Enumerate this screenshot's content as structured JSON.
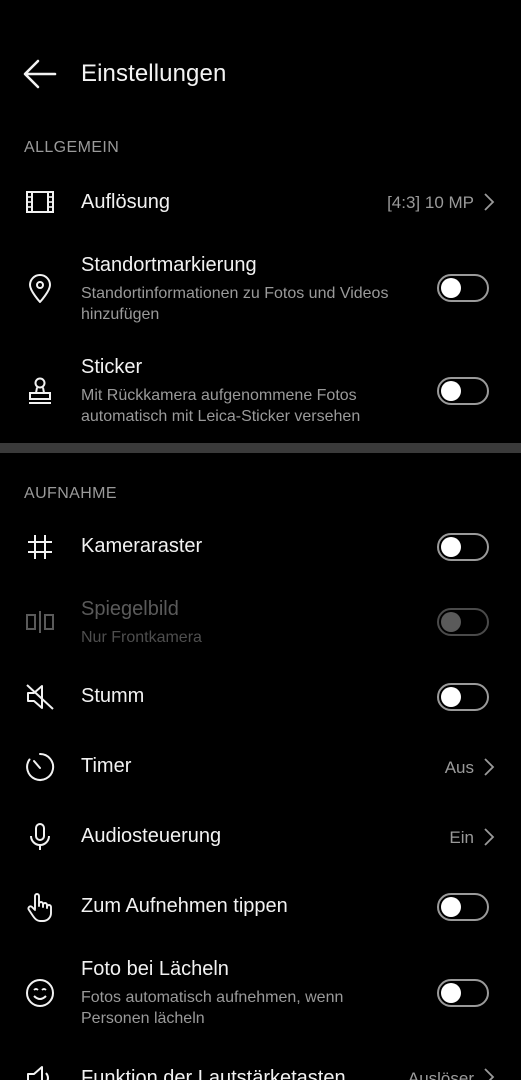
{
  "header": {
    "title": "Einstellungen",
    "back_icon": "arrow-left-icon"
  },
  "sections": {
    "general": {
      "label": "ALLGEMEIN"
    },
    "capture": {
      "label": "AUFNAHME"
    }
  },
  "items": {
    "resolution": {
      "title": "Auflösung",
      "value": "[4:3] 10 MP",
      "icon": "film-frame-icon"
    },
    "location": {
      "title": "Standortmarkierung",
      "subtitle": "Standortinformationen zu Fotos und Videos hinzufügen",
      "enabled": false,
      "icon": "location-pin-icon"
    },
    "sticker": {
      "title": "Sticker",
      "subtitle": "Mit Rückkamera aufgenommene Fotos automatisch mit Leica-Sticker versehen",
      "enabled": false,
      "icon": "stamp-icon"
    },
    "grid": {
      "title": "Kameraraster",
      "enabled": false,
      "icon": "grid-hash-icon"
    },
    "mirror": {
      "title": "Spiegelbild",
      "subtitle": "Nur Frontkamera",
      "enabled": false,
      "disabled": true,
      "icon": "mirror-icon"
    },
    "mute": {
      "title": "Stumm",
      "enabled": false,
      "icon": "speaker-muted-icon"
    },
    "timer": {
      "title": "Timer",
      "value": "Aus",
      "icon": "timer-icon"
    },
    "audio": {
      "title": "Audiosteuerung",
      "value": "Ein",
      "icon": "microphone-icon"
    },
    "tap": {
      "title": "Zum Aufnehmen tippen",
      "enabled": false,
      "icon": "hand-tap-icon"
    },
    "smile": {
      "title": "Foto bei Lächeln",
      "subtitle": "Fotos automatisch aufnehmen, wenn Personen lächeln",
      "enabled": false,
      "icon": "smiley-icon"
    },
    "volume": {
      "title": "Funktion der Lautstärketasten",
      "value": "Auslöser",
      "icon": "speaker-icon"
    }
  },
  "colors": {
    "background": "#000000",
    "primary_text": "#f2f2f2",
    "secondary_text": "#9a9a9a",
    "divider": "#3a3a3a"
  }
}
